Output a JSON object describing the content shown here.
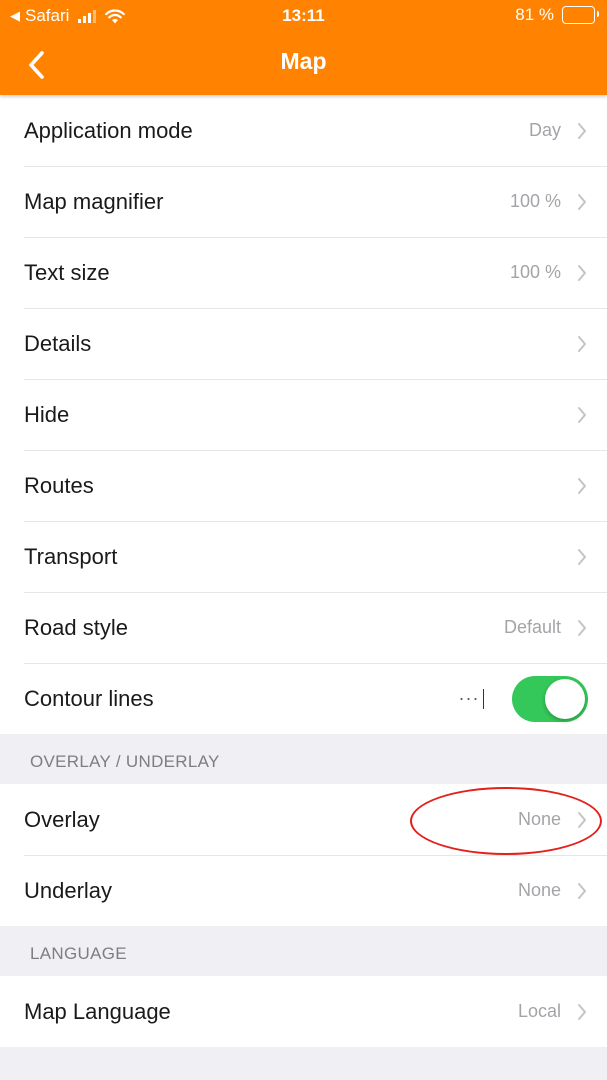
{
  "status_bar": {
    "back_app": "Safari",
    "time": "13:11",
    "battery": "81 %",
    "battery_level": 0.81
  },
  "nav": {
    "title": "Map",
    "back_icon": "chevron-left-icon"
  },
  "colors": {
    "header": "#ff8200",
    "toggle_on": "#34c759",
    "annotation": "#e3201b"
  },
  "main_rows": [
    {
      "label": "Application mode",
      "value": "Day"
    },
    {
      "label": "Map magnifier",
      "value": "100 %"
    },
    {
      "label": "Text size",
      "value": "100 %"
    },
    {
      "label": "Details",
      "value": ""
    },
    {
      "label": "Hide",
      "value": ""
    },
    {
      "label": "Routes",
      "value": ""
    },
    {
      "label": "Transport",
      "value": ""
    },
    {
      "label": "Road style",
      "value": "Default"
    }
  ],
  "contour": {
    "label": "Contour lines",
    "dots": "···",
    "enabled": true
  },
  "overlay_section": {
    "header": "OVERLAY / UNDERLAY",
    "rows": [
      {
        "label": "Overlay",
        "value": "None"
      },
      {
        "label": "Underlay",
        "value": "None"
      }
    ]
  },
  "language_section": {
    "header": "LANGUAGE",
    "rows": [
      {
        "label": "Map Language",
        "value": "Local"
      }
    ]
  }
}
